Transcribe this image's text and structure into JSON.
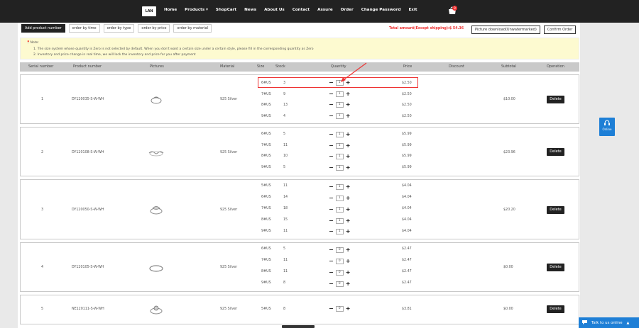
{
  "header": {
    "logo_text": "LAN",
    "nav": [
      "Home",
      "Products ▾",
      "ShopCart",
      "News",
      "About Us",
      "Contact",
      "Assure",
      "Order",
      "Change Password",
      "Exit"
    ],
    "cart_count": "9"
  },
  "toolbar": {
    "add_product": "Add product number",
    "order_by_time": "order by time",
    "order_by_type": "order by type",
    "order_by_price": "order by price",
    "order_by_material": "order by material",
    "total_label": "Total amount(Except shipping):$ 54.36",
    "picture_download": "Picture download(Unwatermarked)",
    "confirm_order": "Confirm Order"
  },
  "note": {
    "title": "Note:",
    "line1": "1. The size system whose quantity is Zero is not selected by default. When you don't want a certain size under a certain style, please fill in the corresponding quantity as Zero",
    "line2": "2. Inventory and price change in real time, we will lock the inventory and price for you after payment"
  },
  "table": {
    "headers": [
      "Serial number",
      "Product number",
      "Pictures",
      "Material",
      "Size",
      "Stock",
      "Quantity",
      "Price",
      "Discount",
      "Subtotal",
      "Operation"
    ]
  },
  "groups": [
    {
      "serial": "1",
      "product": "DY120035-S-W-WH",
      "material": "925 Silver",
      "subtotal": "$10.00",
      "delete": "Delete",
      "rows": [
        {
          "size": "6#US",
          "stock": "3",
          "qty": "1",
          "price": "$2.50"
        },
        {
          "size": "7#US",
          "stock": "9",
          "qty": "1",
          "price": "$2.50"
        },
        {
          "size": "8#US",
          "stock": "13",
          "qty": "1",
          "price": "$2.50"
        },
        {
          "size": "9#US",
          "stock": "4",
          "qty": "1",
          "price": "$2.50"
        }
      ]
    },
    {
      "serial": "2",
      "product": "DY120108-S-W-WH",
      "material": "925 Silver",
      "subtotal": "$23.96",
      "delete": "Delete",
      "rows": [
        {
          "size": "6#US",
          "stock": "5",
          "qty": "1",
          "price": "$5.99"
        },
        {
          "size": "7#US",
          "stock": "11",
          "qty": "1",
          "price": "$5.99"
        },
        {
          "size": "8#US",
          "stock": "10",
          "qty": "1",
          "price": "$5.99"
        },
        {
          "size": "9#US",
          "stock": "5",
          "qty": "1",
          "price": "$5.99"
        }
      ]
    },
    {
      "serial": "3",
      "product": "DY120050-S-W-WH",
      "material": "925 Silver",
      "subtotal": "$20.20",
      "delete": "Delete",
      "rows": [
        {
          "size": "5#US",
          "stock": "11",
          "qty": "1",
          "price": "$4.04"
        },
        {
          "size": "6#US",
          "stock": "14",
          "qty": "1",
          "price": "$4.04"
        },
        {
          "size": "7#US",
          "stock": "18",
          "qty": "1",
          "price": "$4.04"
        },
        {
          "size": "8#US",
          "stock": "15",
          "qty": "1",
          "price": "$4.04"
        },
        {
          "size": "9#US",
          "stock": "11",
          "qty": "1",
          "price": "$4.04"
        }
      ]
    },
    {
      "serial": "4",
      "product": "DY120105-S-W-WH",
      "material": "925 Silver",
      "subtotal": "$0.00",
      "delete": "Delete",
      "rows": [
        {
          "size": "6#US",
          "stock": "5",
          "qty": "0",
          "price": "$2.47"
        },
        {
          "size": "7#US",
          "stock": "11",
          "qty": "0",
          "price": "$2.47"
        },
        {
          "size": "8#US",
          "stock": "11",
          "qty": "0",
          "price": "$2.47"
        },
        {
          "size": "9#US",
          "stock": "8",
          "qty": "0",
          "price": "$2.47"
        }
      ]
    },
    {
      "serial": "5",
      "product": "NE120111-S-W-WH",
      "material": "925 Silver",
      "subtotal": "$0.00",
      "delete": "Delete",
      "rows": [
        {
          "size": "5#US",
          "stock": "8",
          "qty": "0",
          "price": "$3.81"
        }
      ]
    }
  ],
  "widgets": {
    "online": "Online",
    "talk": "Talk to us online",
    "talk_caret": "▲"
  },
  "colors": {
    "accent": "#1e7fd6",
    "highlight": "#e33333",
    "header_bg": "#222222"
  }
}
